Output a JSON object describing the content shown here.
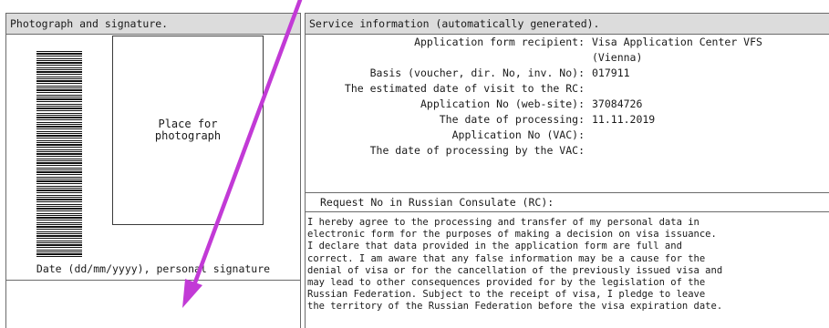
{
  "left_panel": {
    "header": "Photograph and signature.",
    "photo_placeholder": "Place for photograph",
    "signature_label": "Date (dd/mm/yyyy), personal signature"
  },
  "right_panel": {
    "header": "Service information (automatically generated).",
    "rows": [
      {
        "label": "Application form recipient:",
        "value": "Visa Application Center VFS"
      },
      {
        "label": "",
        "value": "(Vienna)"
      },
      {
        "label": "Basis (voucher, dir. No, inv. No):",
        "value": "017911"
      },
      {
        "label": "The estimated date of visit to the RC:",
        "value": ""
      },
      {
        "label": "Application No (web-site):",
        "value": "37084726"
      },
      {
        "label": "The date of processing:",
        "value": "11.11.2019"
      },
      {
        "label": "Application No (VAC):",
        "value": ""
      },
      {
        "label": "The date of processing by the VAC:",
        "value": ""
      }
    ],
    "request_label": "Request No in Russian Consulate (RC):",
    "consent_lines": [
      "I hereby agree to the processing and transfer of my personal data in",
      "electronic form for the purposes of making a decision on visa issuance.",
      "I declare that data provided in the application form are full and",
      "correct. I am aware that any false information may be a cause for the",
      "denial of visa or for the cancellation of the previously issued visa and",
      "may lead to other consequences provided for by the legislation of the",
      "Russian Federation. Subject to the receipt of visa, I pledge to leave",
      "the territory of the Russian Federation before the visa expiration date."
    ]
  },
  "colors": {
    "header_bg": "#dcdcdc",
    "border": "#6b6b6b",
    "arrow": "#c23ad6"
  }
}
